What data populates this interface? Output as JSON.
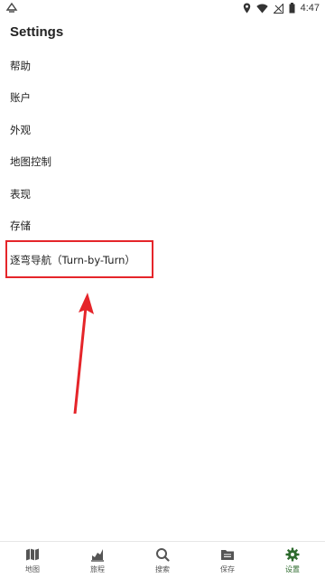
{
  "status_bar": {
    "time": "4:47"
  },
  "header": {
    "title": "Settings"
  },
  "settings": {
    "items": [
      {
        "label": "帮助"
      },
      {
        "label": "账户"
      },
      {
        "label": "外观"
      },
      {
        "label": "地图控制"
      },
      {
        "label": "表现"
      },
      {
        "label": "存储"
      },
      {
        "label": "逐弯导航（Turn-by-Turn）"
      }
    ]
  },
  "bottom_nav": {
    "items": [
      {
        "label": "地图",
        "icon": "map-icon"
      },
      {
        "label": "旅程",
        "icon": "chart-icon"
      },
      {
        "label": "搜索",
        "icon": "search-icon"
      },
      {
        "label": "保存",
        "icon": "folder-icon"
      },
      {
        "label": "设置",
        "icon": "gear-icon",
        "active": true
      }
    ]
  },
  "colors": {
    "accent": "#2e6b2e",
    "annotation": "#e5252a"
  }
}
